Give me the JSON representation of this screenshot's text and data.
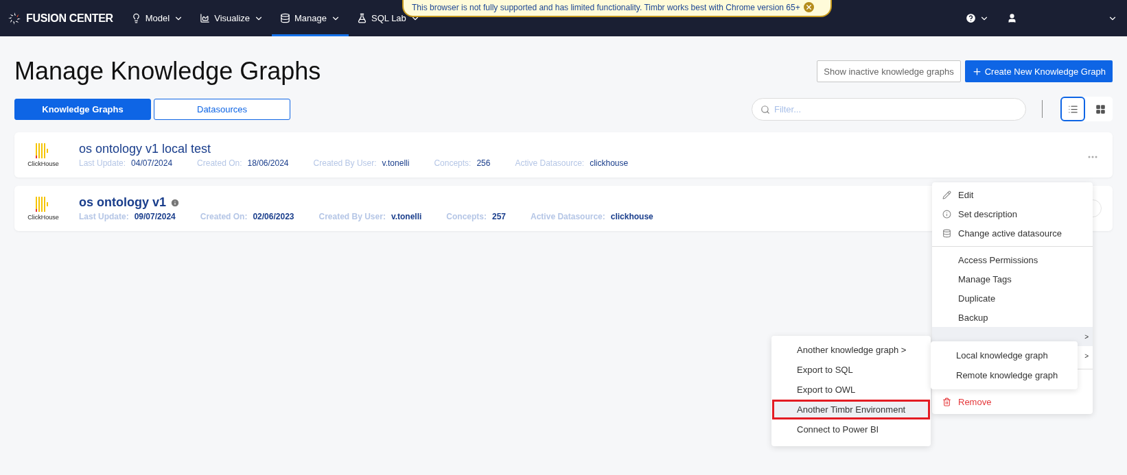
{
  "banner": {
    "text": "This browser is not fully supported and has limited functionality. Timbr works best with Chrome version 65+"
  },
  "nav": {
    "brand": "FUSION CENTER",
    "items": [
      {
        "label": "Model",
        "selected": false
      },
      {
        "label": "Visualize",
        "selected": false
      },
      {
        "label": "Manage",
        "selected": true
      },
      {
        "label": "SQL Lab",
        "selected": false
      }
    ]
  },
  "page": {
    "title": "Manage Knowledge Graphs",
    "show_inactive": "Show inactive knowledge graphs",
    "create": "Create New Knowledge Graph"
  },
  "tabs": [
    {
      "label": "Knowledge Graphs",
      "selected": true
    },
    {
      "label": "Datasources",
      "selected": false
    }
  ],
  "filter": {
    "placeholder": "Filter..."
  },
  "view_modes": [
    {
      "kind": "list",
      "selected": true
    },
    {
      "kind": "grid",
      "selected": false
    }
  ],
  "cards": [
    {
      "title": "os ontology v1 local test",
      "logo_text": "ClickHouse",
      "emphasized": false,
      "info": false,
      "fields": [
        {
          "label": "Last Update:",
          "value": "04/07/2024"
        },
        {
          "label": "Created On:",
          "value": "18/06/2024"
        },
        {
          "label": "Created By User:",
          "value": "v.tonelli"
        },
        {
          "label": "Concepts:",
          "value": "256"
        },
        {
          "label": "Active Datasource:",
          "value": "clickhouse"
        }
      ]
    },
    {
      "title": "os ontology v1",
      "logo_text": "ClickHouse",
      "emphasized": true,
      "info": true,
      "fields": [
        {
          "label": "Last Update:",
          "value": "09/07/2024"
        },
        {
          "label": "Created On:",
          "value": "02/06/2023"
        },
        {
          "label": "Created By User:",
          "value": "v.tonelli"
        },
        {
          "label": "Concepts:",
          "value": "257"
        },
        {
          "label": "Active Datasource:",
          "value": "clickhouse"
        }
      ]
    }
  ],
  "menu": [
    {
      "kind": "edit",
      "label": "Edit"
    },
    {
      "kind": "describe",
      "label": "Set description"
    },
    {
      "kind": "datasource",
      "label": "Change active datasource"
    },
    {
      "kind": "divider"
    },
    {
      "kind": "plain",
      "label": "Access Permissions"
    },
    {
      "kind": "plain",
      "label": "Manage Tags"
    },
    {
      "kind": "plain",
      "label": "Duplicate"
    },
    {
      "kind": "plain",
      "label": "Backup"
    },
    {
      "kind": "arrow",
      "label": ">",
      "selected": true
    },
    {
      "kind": "arrow",
      "label": ">",
      "selected": false
    },
    {
      "kind": "divider"
    },
    {
      "kind": "blank"
    },
    {
      "kind": "remove",
      "label": "Remove"
    }
  ],
  "export_menu": [
    {
      "label": "Another knowledge graph >",
      "highlighted": false
    },
    {
      "label": "Export to SQL",
      "highlighted": false
    },
    {
      "label": "Export to OWL",
      "highlighted": false
    },
    {
      "label": "Another Timbr Environment",
      "highlighted": true
    },
    {
      "label": "Connect to Power BI",
      "highlighted": false
    }
  ],
  "graph_menu": [
    {
      "label": "Local knowledge graph"
    },
    {
      "label": "Remote knowledge graph"
    }
  ]
}
